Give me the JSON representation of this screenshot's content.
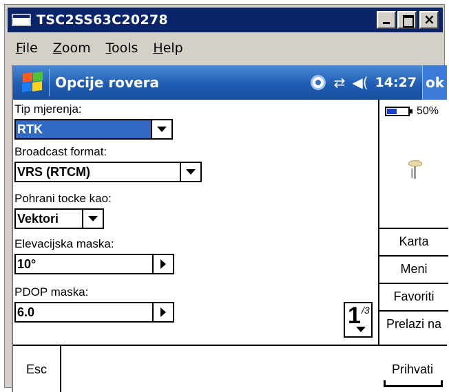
{
  "window": {
    "title": "TSC2SS63C20278"
  },
  "menubar": {
    "file_first": "F",
    "file_rest": "ile",
    "zoom_first": "Z",
    "zoom_rest": "oom",
    "tools_first": "T",
    "tools_rest": "ools",
    "help_first": "H",
    "help_rest": "elp"
  },
  "navbar": {
    "title": "Opcije rovera",
    "time": "14:27",
    "ok_label": "ok",
    "icons": [
      "gps-status-icon",
      "connectivity-icon",
      "volume-icon"
    ]
  },
  "form": {
    "fields": [
      {
        "label": "Tip mjerenja:",
        "value": "RTK"
      },
      {
        "label": "Broadcast format:",
        "value": "VRS (RTCM)"
      },
      {
        "label": "Pohrani tocke kao:",
        "value": "Vektori"
      },
      {
        "label": "Elevacijska maska:",
        "value": "10°"
      },
      {
        "label": "PDOP maska:",
        "value": "6.0"
      }
    ],
    "pager": {
      "current": "1",
      "total": "/3"
    }
  },
  "right_panel": {
    "battery_percent": "50%",
    "battery_level": 0.5,
    "buttons": [
      {
        "label": "Karta"
      },
      {
        "label": "Meni"
      },
      {
        "label": "Favoriti"
      },
      {
        "label": "Prelazi na"
      }
    ]
  },
  "bottom": {
    "esc_label": "Esc",
    "accept_label": "Prihvati"
  },
  "colors": {
    "titlebar": "#0a246a",
    "navbar": "#1f5db4",
    "selection": "#316ac5"
  }
}
